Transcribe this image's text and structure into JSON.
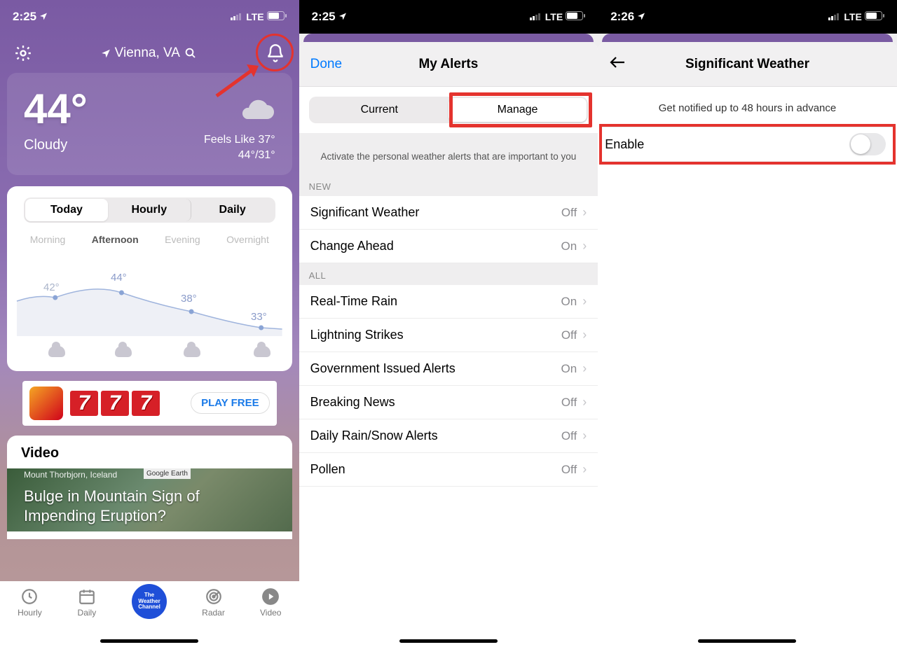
{
  "screen1": {
    "status": {
      "time": "2:25",
      "network": "LTE"
    },
    "location": "Vienna, VA",
    "temp": "44°",
    "condition": "Cloudy",
    "feels_like": "Feels Like 37°",
    "hilo": "44°/31°",
    "seg": {
      "today": "Today",
      "hourly": "Hourly",
      "daily": "Daily"
    },
    "parts": [
      "Morning",
      "Afternoon",
      "Evening",
      "Overnight"
    ],
    "chart_temps": [
      "42°",
      "44°",
      "38°",
      "33°"
    ],
    "ad_cta": "PLAY FREE",
    "video_header": "Video",
    "video_loc": "Mount Thorbjorn, Iceland",
    "video_src": "Google Earth",
    "video_title": "Bulge in Mountain Sign of Impending Eruption?",
    "tabs": {
      "hourly": "Hourly",
      "daily": "Daily",
      "radar": "Radar",
      "video": "Video"
    }
  },
  "screen2": {
    "status": {
      "time": "2:25",
      "network": "LTE"
    },
    "done": "Done",
    "title": "My Alerts",
    "seg": {
      "current": "Current",
      "manage": "Manage"
    },
    "hint": "Activate the personal weather alerts that are important to you",
    "section_new": "NEW",
    "section_all": "ALL",
    "rows_new": [
      {
        "label": "Significant Weather",
        "val": "Off"
      },
      {
        "label": "Change Ahead",
        "val": "On"
      }
    ],
    "rows_all": [
      {
        "label": "Real-Time Rain",
        "val": "On"
      },
      {
        "label": "Lightning Strikes",
        "val": "Off"
      },
      {
        "label": "Government Issued Alerts",
        "val": "On"
      },
      {
        "label": "Breaking News",
        "val": "Off"
      },
      {
        "label": "Daily Rain/Snow Alerts",
        "val": "Off"
      },
      {
        "label": "Pollen",
        "val": "Off"
      }
    ]
  },
  "screen3": {
    "status": {
      "time": "2:26",
      "network": "LTE"
    },
    "title": "Significant Weather",
    "info": "Get notified up to 48 hours in advance",
    "enable_label": "Enable"
  }
}
